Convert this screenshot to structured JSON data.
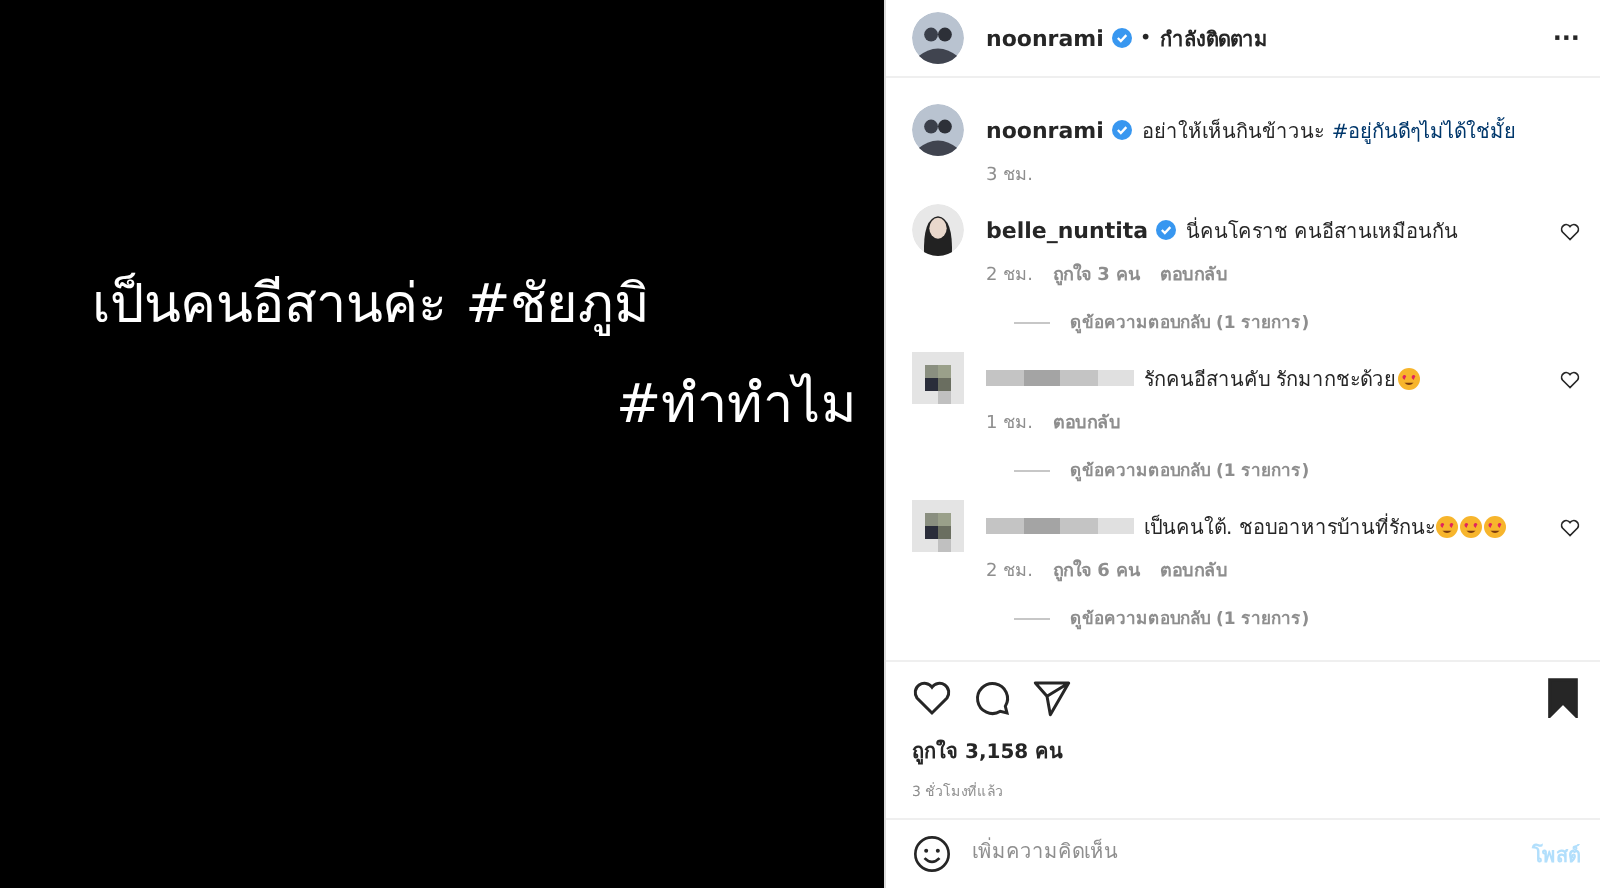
{
  "photo": {
    "lines": [
      "เป็นคนอีสานค่ะ #ชัยภูมิ",
      "#ทำทำไม"
    ]
  },
  "header": {
    "username": "noonrami",
    "verified": true,
    "separator": "•",
    "follow_label": "กำลังติดตาม",
    "more": "···"
  },
  "caption": {
    "username": "noonrami",
    "verified": true,
    "text": "อย่าให้เห็นกินข้าวนะ",
    "hashtag": "#อยู่กันดีๆไม่ได้ใช่มั้ย",
    "time": "3 ชม."
  },
  "comments": [
    {
      "username": "belle_nuntita",
      "name_hidden": false,
      "verified": true,
      "text": "นี่คนโคราช คนอีสานเหมือนกัน",
      "time": "2 ชม.",
      "likes": "ถูกใจ 3 คน",
      "reply": "ตอบกลับ",
      "view_replies": "ดูข้อความตอบกลับ (1 รายการ)",
      "liked": false
    },
    {
      "name_hidden": true,
      "verified": false,
      "text": "รักคนอีสานคับ รักมากชะด้วย",
      "reactions": [
        {
          "kind": "heart-eyes"
        }
      ],
      "time": "1 ชม.",
      "reply": "ตอบกลับ",
      "view_replies": "ดูข้อความตอบกลับ (1 รายการ)",
      "liked": false
    },
    {
      "name_hidden": true,
      "verified": false,
      "text": "เป็นคนใต้. ชอบอาหารบ้านที่รักนะ",
      "reactions": [
        {
          "kind": "heart-eyes"
        },
        {
          "kind": "heart-eyes"
        },
        {
          "kind": "heart-eyes"
        }
      ],
      "time": "2 ชม.",
      "likes": "ถูกใจ 6 คน",
      "reply": "ตอบกลับ",
      "view_replies": "ดูข้อความตอบกลับ (1 รายการ)",
      "liked": false
    }
  ],
  "actions": {
    "liked": false,
    "saved": true
  },
  "likes": "ถูกใจ 3,158 คน",
  "posted": "3 ชั่วโมงที่แล้ว",
  "comment_box": {
    "placeholder": "เพิ่มความคิดเห็น",
    "post": "โพสต์"
  }
}
